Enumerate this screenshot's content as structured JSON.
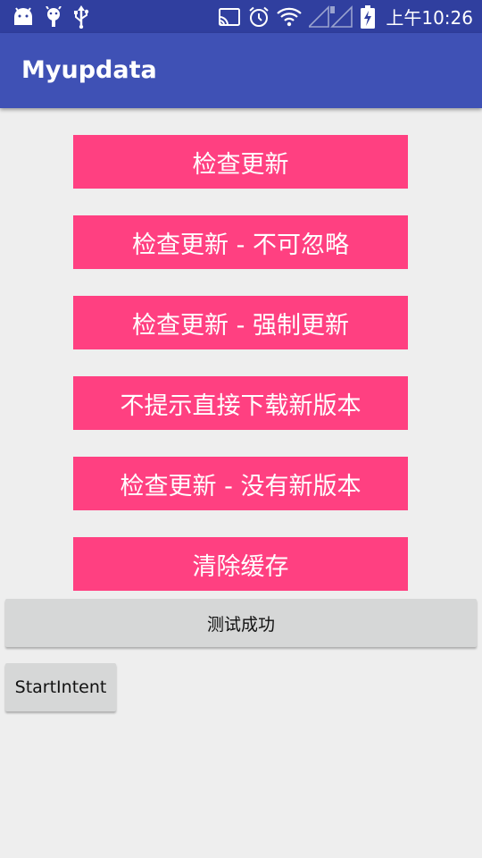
{
  "status_bar": {
    "time": "上午10:26",
    "left_icons": [
      "android-icon",
      "debug-icon",
      "usb-icon"
    ],
    "right_icons": [
      "cast-icon",
      "alarm-icon",
      "wifi-icon",
      "signal-icon",
      "battery-charging-icon"
    ]
  },
  "app_bar": {
    "title": "Myupdata"
  },
  "buttons": [
    {
      "label": "检查更新"
    },
    {
      "label": "检查更新 - 不可忽略"
    },
    {
      "label": "检查更新 - 强制更新"
    },
    {
      "label": "不提示直接下载新版本"
    },
    {
      "label": "检查更新 - 没有新版本"
    },
    {
      "label": "清除缓存"
    }
  ],
  "test_button": {
    "label": "测试成功"
  },
  "start_intent_button": {
    "label": "StartIntent"
  },
  "colors": {
    "status_bar": "#303f9f",
    "app_bar": "#3f51b5",
    "accent": "#ff4081",
    "background": "#eeeeee",
    "gray_button": "#d6d7d7"
  }
}
